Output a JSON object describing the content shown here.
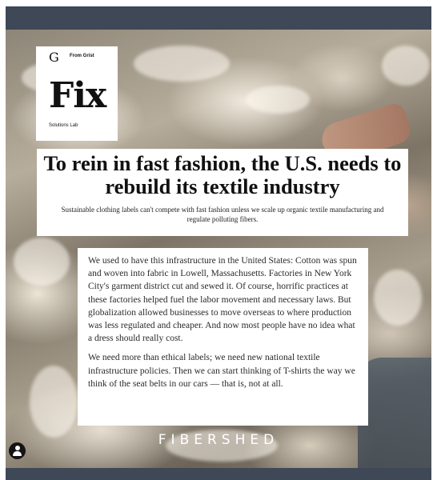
{
  "logo": {
    "mark": "G",
    "from": "From Grist",
    "title": "Fix",
    "subtitle": "Solutions Lab"
  },
  "headline": {
    "title": "To rein in fast fashion, the U.S. needs to rebuild its textile industry",
    "subtitle": "Sustainable clothing labels can't compete with fast fashion unless we scale up organic textile manufacturing and regulate polluting fibers."
  },
  "body": {
    "paragraphs": [
      "We used to have this infrastructure in the United States: Cotton was spun and woven into fabric in Lowell, Massachusetts. Factories in New York City's garment district cut and sewed it. Of course, horrific practices at these factories helped fuel the labor movement and necessary laws. But globalization allowed businesses to move overseas to where production was less regulated and cheaper. And now most people have no idea what a dress should really cost.",
      "We need more than ethical labels; we need new national textile infrastructure policies. Then we can start thinking of T-shirts the way we think of the seat belts in our cars — that is, not at all."
    ]
  },
  "brand": "FIBERSHED",
  "icons": {
    "user": "user-icon"
  },
  "colors": {
    "frame": "#3e4856",
    "card": "#ffffff",
    "text": "#111111"
  }
}
